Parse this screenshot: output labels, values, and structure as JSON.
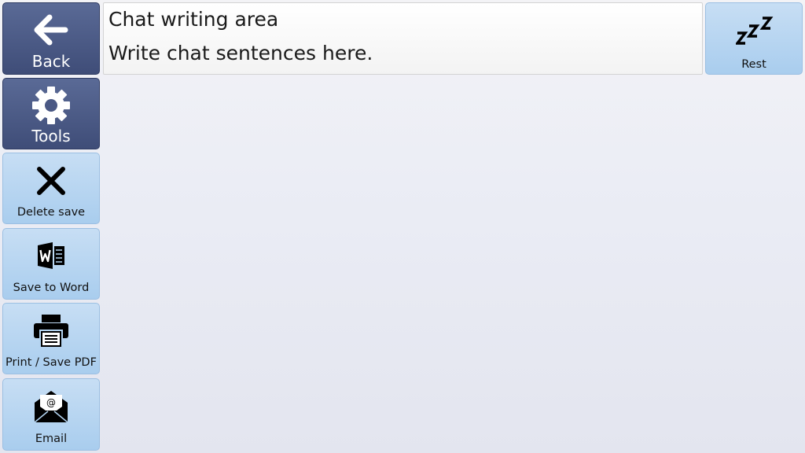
{
  "sidebar": {
    "back": {
      "label": "Back",
      "icon": "arrow-left-icon"
    },
    "tools": {
      "label": "Tools",
      "icon": "gear-icon"
    },
    "delete_save": {
      "label": "Delete save",
      "icon": "close-icon"
    },
    "save_to_word": {
      "label": "Save to Word",
      "icon": "word-icon"
    },
    "print": {
      "label": "Print / Save PDF",
      "icon": "printer-icon"
    },
    "email": {
      "label": "Email",
      "icon": "envelope-icon"
    }
  },
  "chat": {
    "title": "Chat writing area",
    "placeholder": "Write chat sentences here."
  },
  "rest": {
    "label": "Rest",
    "icon": "sleep-icon"
  },
  "colors": {
    "dark_tile": "#4a5884",
    "light_tile": "#b3d3f0",
    "background": "#eceef5"
  }
}
